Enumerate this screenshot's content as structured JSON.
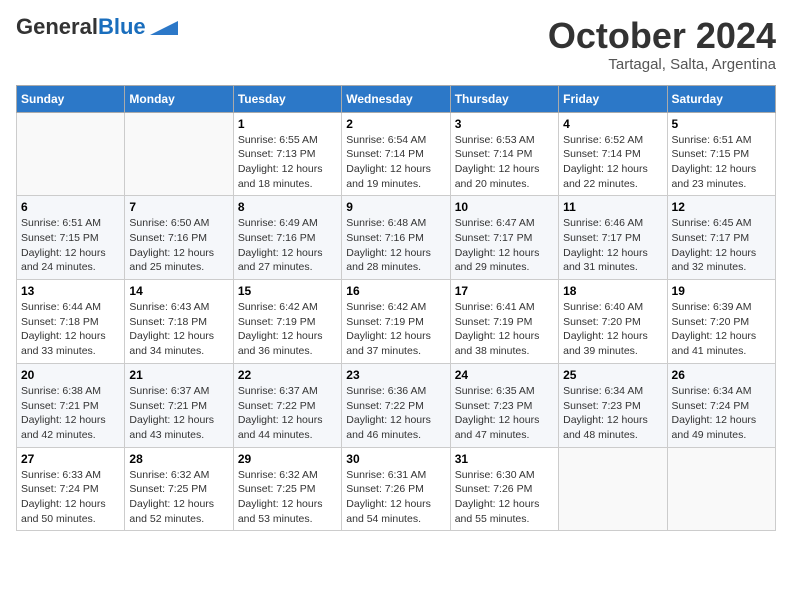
{
  "header": {
    "logo_general": "General",
    "logo_blue": "Blue",
    "month_year": "October 2024",
    "location": "Tartagal, Salta, Argentina"
  },
  "weekdays": [
    "Sunday",
    "Monday",
    "Tuesday",
    "Wednesday",
    "Thursday",
    "Friday",
    "Saturday"
  ],
  "weeks": [
    [
      {
        "day": "",
        "text": ""
      },
      {
        "day": "",
        "text": ""
      },
      {
        "day": "1",
        "text": "Sunrise: 6:55 AM\nSunset: 7:13 PM\nDaylight: 12 hours and 18 minutes."
      },
      {
        "day": "2",
        "text": "Sunrise: 6:54 AM\nSunset: 7:14 PM\nDaylight: 12 hours and 19 minutes."
      },
      {
        "day": "3",
        "text": "Sunrise: 6:53 AM\nSunset: 7:14 PM\nDaylight: 12 hours and 20 minutes."
      },
      {
        "day": "4",
        "text": "Sunrise: 6:52 AM\nSunset: 7:14 PM\nDaylight: 12 hours and 22 minutes."
      },
      {
        "day": "5",
        "text": "Sunrise: 6:51 AM\nSunset: 7:15 PM\nDaylight: 12 hours and 23 minutes."
      }
    ],
    [
      {
        "day": "6",
        "text": "Sunrise: 6:51 AM\nSunset: 7:15 PM\nDaylight: 12 hours and 24 minutes."
      },
      {
        "day": "7",
        "text": "Sunrise: 6:50 AM\nSunset: 7:16 PM\nDaylight: 12 hours and 25 minutes."
      },
      {
        "day": "8",
        "text": "Sunrise: 6:49 AM\nSunset: 7:16 PM\nDaylight: 12 hours and 27 minutes."
      },
      {
        "day": "9",
        "text": "Sunrise: 6:48 AM\nSunset: 7:16 PM\nDaylight: 12 hours and 28 minutes."
      },
      {
        "day": "10",
        "text": "Sunrise: 6:47 AM\nSunset: 7:17 PM\nDaylight: 12 hours and 29 minutes."
      },
      {
        "day": "11",
        "text": "Sunrise: 6:46 AM\nSunset: 7:17 PM\nDaylight: 12 hours and 31 minutes."
      },
      {
        "day": "12",
        "text": "Sunrise: 6:45 AM\nSunset: 7:17 PM\nDaylight: 12 hours and 32 minutes."
      }
    ],
    [
      {
        "day": "13",
        "text": "Sunrise: 6:44 AM\nSunset: 7:18 PM\nDaylight: 12 hours and 33 minutes."
      },
      {
        "day": "14",
        "text": "Sunrise: 6:43 AM\nSunset: 7:18 PM\nDaylight: 12 hours and 34 minutes."
      },
      {
        "day": "15",
        "text": "Sunrise: 6:42 AM\nSunset: 7:19 PM\nDaylight: 12 hours and 36 minutes."
      },
      {
        "day": "16",
        "text": "Sunrise: 6:42 AM\nSunset: 7:19 PM\nDaylight: 12 hours and 37 minutes."
      },
      {
        "day": "17",
        "text": "Sunrise: 6:41 AM\nSunset: 7:19 PM\nDaylight: 12 hours and 38 minutes."
      },
      {
        "day": "18",
        "text": "Sunrise: 6:40 AM\nSunset: 7:20 PM\nDaylight: 12 hours and 39 minutes."
      },
      {
        "day": "19",
        "text": "Sunrise: 6:39 AM\nSunset: 7:20 PM\nDaylight: 12 hours and 41 minutes."
      }
    ],
    [
      {
        "day": "20",
        "text": "Sunrise: 6:38 AM\nSunset: 7:21 PM\nDaylight: 12 hours and 42 minutes."
      },
      {
        "day": "21",
        "text": "Sunrise: 6:37 AM\nSunset: 7:21 PM\nDaylight: 12 hours and 43 minutes."
      },
      {
        "day": "22",
        "text": "Sunrise: 6:37 AM\nSunset: 7:22 PM\nDaylight: 12 hours and 44 minutes."
      },
      {
        "day": "23",
        "text": "Sunrise: 6:36 AM\nSunset: 7:22 PM\nDaylight: 12 hours and 46 minutes."
      },
      {
        "day": "24",
        "text": "Sunrise: 6:35 AM\nSunset: 7:23 PM\nDaylight: 12 hours and 47 minutes."
      },
      {
        "day": "25",
        "text": "Sunrise: 6:34 AM\nSunset: 7:23 PM\nDaylight: 12 hours and 48 minutes."
      },
      {
        "day": "26",
        "text": "Sunrise: 6:34 AM\nSunset: 7:24 PM\nDaylight: 12 hours and 49 minutes."
      }
    ],
    [
      {
        "day": "27",
        "text": "Sunrise: 6:33 AM\nSunset: 7:24 PM\nDaylight: 12 hours and 50 minutes."
      },
      {
        "day": "28",
        "text": "Sunrise: 6:32 AM\nSunset: 7:25 PM\nDaylight: 12 hours and 52 minutes."
      },
      {
        "day": "29",
        "text": "Sunrise: 6:32 AM\nSunset: 7:25 PM\nDaylight: 12 hours and 53 minutes."
      },
      {
        "day": "30",
        "text": "Sunrise: 6:31 AM\nSunset: 7:26 PM\nDaylight: 12 hours and 54 minutes."
      },
      {
        "day": "31",
        "text": "Sunrise: 6:30 AM\nSunset: 7:26 PM\nDaylight: 12 hours and 55 minutes."
      },
      {
        "day": "",
        "text": ""
      },
      {
        "day": "",
        "text": ""
      }
    ]
  ]
}
